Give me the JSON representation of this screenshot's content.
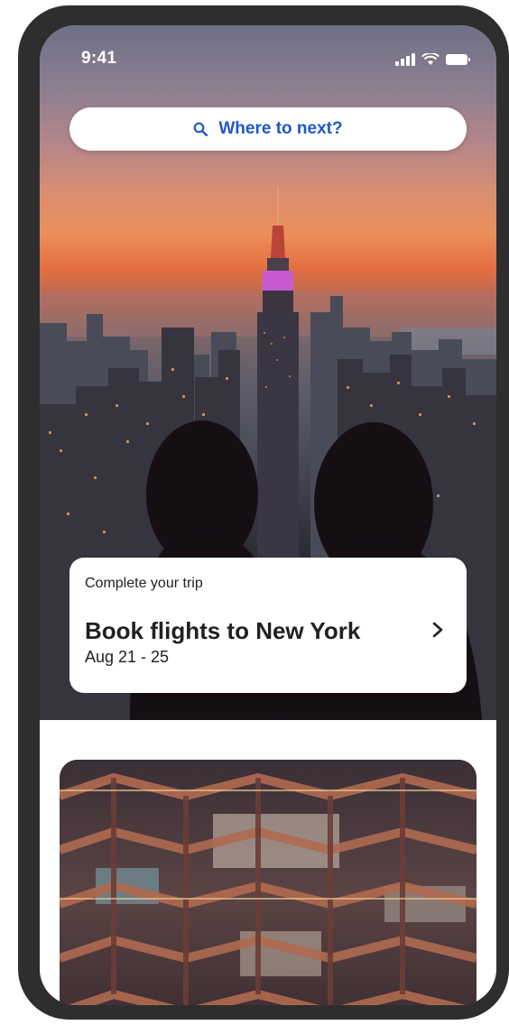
{
  "status_bar": {
    "time": "9:41",
    "icons": [
      "cellular-signal-icon",
      "wifi-icon",
      "battery-icon"
    ]
  },
  "search": {
    "icon": "search-icon",
    "label": "Where to next?"
  },
  "trip_card": {
    "eyebrow": "Complete your trip",
    "title": "Book flights to New York",
    "dates": "Aug 21 - 25",
    "chevron_icon": "chevron-right-icon"
  },
  "colors": {
    "accent_blue": "#1f58c9",
    "text_dark": "#202124",
    "phone_frame": "#2e2e2e"
  }
}
